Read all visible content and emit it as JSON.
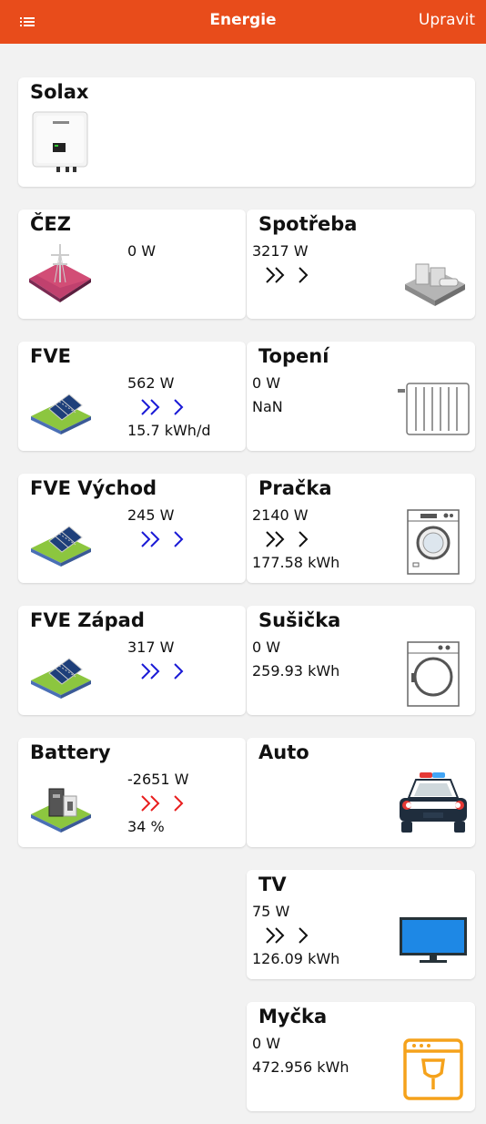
{
  "header": {
    "title": "Energie",
    "edit_label": "Upravit",
    "menu_icon": "menu-icon",
    "color": "#e84c1b"
  },
  "colors": {
    "flow_in": "#1a1ad6",
    "flow_out": "#e81e1e",
    "neutral": "#111111",
    "accent": "#f5a21b"
  },
  "inverter": {
    "name": "Solax",
    "icon": "inverter-icon"
  },
  "sources": [
    {
      "name": "ČEZ",
      "power": "0 W",
      "icon": "grid-icon"
    },
    {
      "name": "FVE",
      "power": "562 W",
      "daily": "15.7 kWh/d",
      "icon": "solar-panel-icon"
    },
    {
      "name": "FVE Východ",
      "power": "245 W",
      "icon": "solar-panel-icon"
    },
    {
      "name": "FVE Západ",
      "power": "317 W",
      "icon": "solar-panel-icon"
    },
    {
      "name": "Battery",
      "power": "-2651 W",
      "soc": "34 %",
      "icon": "battery-icon"
    }
  ],
  "consumers": [
    {
      "name": "Spotřeba",
      "power": "3217 W",
      "icon": "house-icon"
    },
    {
      "name": "Topení",
      "power": "0 W",
      "energy": "NaN",
      "icon": "radiator-icon"
    },
    {
      "name": "Pračka",
      "power": "2140 W",
      "energy": "177.58 kWh",
      "icon": "washing-machine-icon"
    },
    {
      "name": "Sušička",
      "power": "0 W",
      "energy": "259.93 kWh",
      "icon": "dryer-icon"
    },
    {
      "name": "Auto",
      "icon": "car-icon"
    },
    {
      "name": "TV",
      "power": "75 W",
      "energy": "126.09 kWh",
      "icon": "tv-icon"
    },
    {
      "name": "Myčka",
      "power": "0 W",
      "energy": "472.956 kWh",
      "icon": "dishwasher-icon"
    }
  ]
}
